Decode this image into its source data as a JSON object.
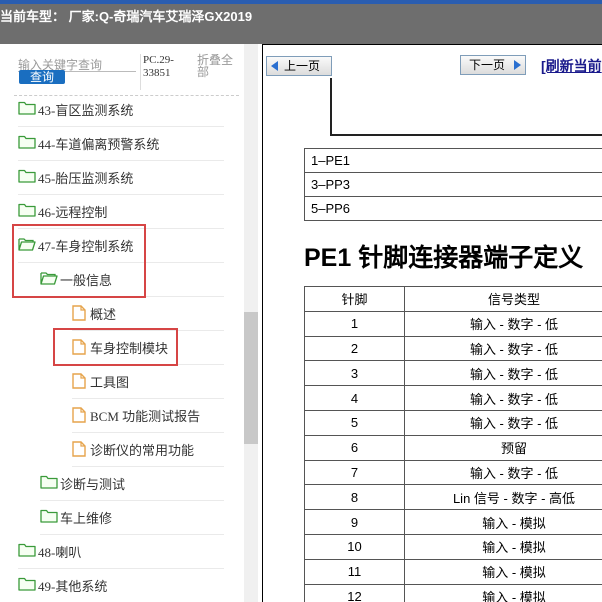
{
  "window": {
    "title": "当前车型： 厂家:Q-奇瑞汽车艾瑞泽GX2019"
  },
  "sidebar": {
    "search_placeholder": "输入关键字查询",
    "query_label": "查询",
    "model_code": "PC.29-33851",
    "collapse_label": "折叠全部",
    "items": [
      {
        "label": "43-盲区监测系统",
        "level": 0
      },
      {
        "label": "44-车道偏离预警系统",
        "level": 0
      },
      {
        "label": "45-胎压监测系统",
        "level": 0
      },
      {
        "label": "46-远程控制",
        "level": 0
      },
      {
        "label": "47-车身控制系统",
        "level": 0
      },
      {
        "label": "一般信息",
        "level": 1
      },
      {
        "label": "概述",
        "level": 2
      },
      {
        "label": "车身控制模块",
        "level": 2
      },
      {
        "label": "工具图",
        "level": 2
      },
      {
        "label": "BCM 功能测试报告",
        "level": 2
      },
      {
        "label": "诊断仪的常用功能",
        "level": 2
      },
      {
        "label": "诊断与测试",
        "level": 1
      },
      {
        "label": "车上维修",
        "level": 1
      },
      {
        "label": "48-喇叭",
        "level": 0
      },
      {
        "label": "49-其他系统",
        "level": 0
      }
    ]
  },
  "toolbar": {
    "prev_label": "上一页",
    "next_label": "下一页",
    "refresh_label": "[刷新当前"
  },
  "document": {
    "connector_list": [
      "1–PE1",
      "3–PP3",
      "5–PP6"
    ],
    "heading": "PE1 针脚连接器端子定义",
    "table": {
      "headers": [
        "针脚",
        "信号类型"
      ],
      "rows": [
        [
          "1",
          "输入 - 数字 - 低"
        ],
        [
          "2",
          "输入 - 数字 - 低"
        ],
        [
          "3",
          "输入 - 数字 - 低"
        ],
        [
          "4",
          "输入 - 数字 - 低"
        ],
        [
          "5",
          "输入 - 数字 - 低"
        ],
        [
          "6",
          "预留"
        ],
        [
          "7",
          "输入 - 数字 - 低"
        ],
        [
          "8",
          "Lin 信号 - 数字 - 高低"
        ],
        [
          "9",
          "输入 - 模拟"
        ],
        [
          "10",
          "输入 - 模拟"
        ],
        [
          "11",
          "输入 - 模拟"
        ],
        [
          "12",
          "输入 - 模拟"
        ]
      ]
    }
  },
  "colors": {
    "accent": "#1a6ec0",
    "highlight": "#d64545",
    "folder": "#3a9a3a",
    "page_icon": "#e6a44c"
  }
}
